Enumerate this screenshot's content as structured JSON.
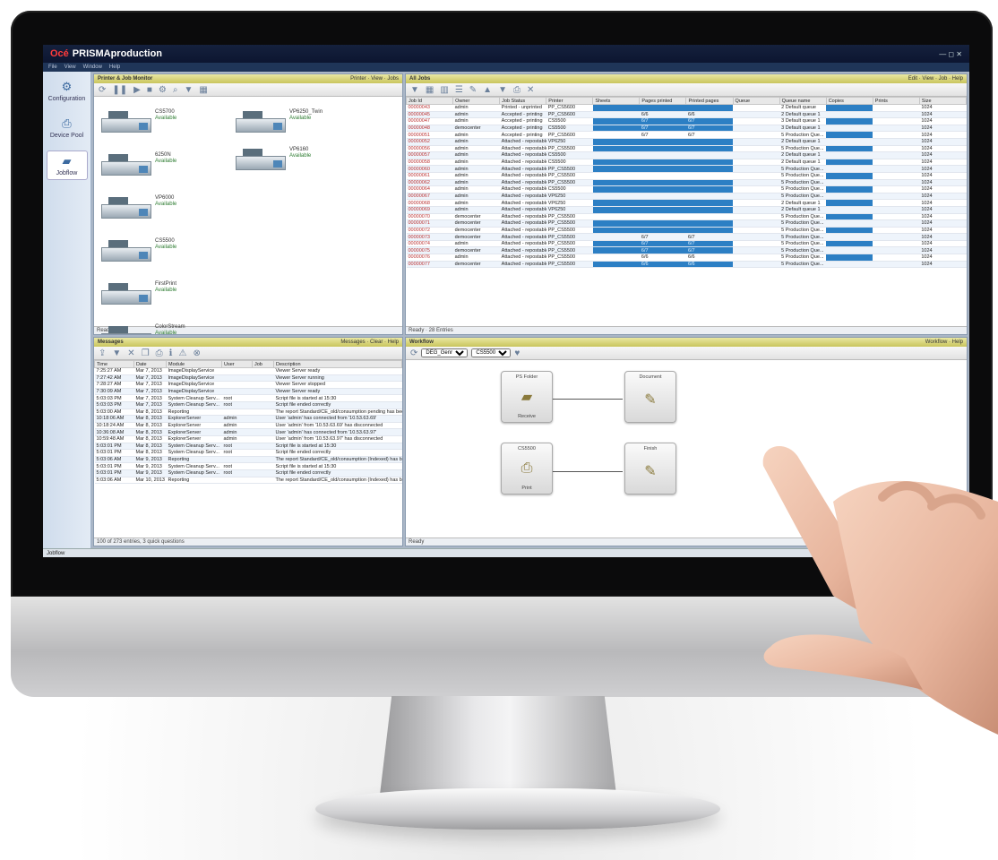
{
  "app": {
    "brand": "Océ",
    "title": "PRISMAproduction",
    "window_controls": "— ◻ ✕",
    "menu": [
      "File",
      "View",
      "Window",
      "Help"
    ]
  },
  "nav": [
    {
      "label": "Configuration",
      "icon": "gear-icon"
    },
    {
      "label": "Device Pool",
      "icon": "printer-icon"
    },
    {
      "label": "Jobflow",
      "icon": "folder-icon"
    }
  ],
  "printers_pane": {
    "title": "Printer & Job Monitor",
    "links": "Printer · View · Jobs",
    "status": "Ready",
    "printers": [
      {
        "name": "CS5700",
        "status": "Available"
      },
      {
        "name": "VP6250_Twin",
        "status": "Available"
      },
      {
        "name": "6250N",
        "status": "Available"
      },
      {
        "name": "VP6160",
        "status": "Available"
      },
      {
        "name": "VP6000",
        "status": "Available"
      },
      {
        "name": "CS5500",
        "status": "Available"
      },
      {
        "name": "FirstPrint",
        "status": "Available"
      },
      {
        "name": "ColorStream",
        "status": "Available"
      }
    ]
  },
  "jobs_pane": {
    "title": "All Jobs",
    "links": "Edit · View · Job · Help",
    "status": "Ready · 28 Entries",
    "columns": [
      "Job Id",
      "Owner",
      "Job Status",
      "Printer",
      "Sheets",
      "Pages printed",
      "Printed pages",
      "Queue",
      "Queue name",
      "Copies",
      "Prints",
      "Size"
    ],
    "rows": [
      [
        "00000043",
        "admin",
        "Printed - unprinted",
        "PP_CS5600",
        "",
        "",
        "",
        "",
        "2 Default queue",
        "",
        "",
        "1024"
      ],
      [
        "00000045",
        "admin",
        "Accepted - printing",
        "PP_CS5600",
        "",
        "6/6",
        "6/6",
        "",
        "2 Default queue 1",
        "",
        "",
        "1024"
      ],
      [
        "00000047",
        "admin",
        "Accepted - printing",
        "CS5500",
        "",
        "6/7",
        "6/7",
        "",
        "3 Default queue 1",
        "",
        "",
        "1024"
      ],
      [
        "00000048",
        "democenter",
        "Accepted - printing",
        "CS5500",
        "",
        "6/7",
        "6/7",
        "",
        "3 Default queue 1",
        "",
        "",
        "1024"
      ],
      [
        "00000051",
        "admin",
        "Accepted - printing",
        "PP_CS5600",
        "",
        "6/7",
        "6/7",
        "",
        "5 Production Que...",
        "",
        "",
        "1024"
      ],
      [
        "00000052",
        "admin",
        "Attached - repostable",
        "VP6250",
        "",
        "",
        "",
        "",
        "2 Default queue 1",
        "",
        "",
        "1024"
      ],
      [
        "00000056",
        "admin",
        "Attached - repostable",
        "PP_CS5500",
        "",
        "",
        "",
        "",
        "5 Production Que...",
        "",
        "",
        "1024"
      ],
      [
        "00000057",
        "admin",
        "Attached - repostable",
        "CS5500",
        "",
        "",
        "",
        "",
        "2 Default queue 1",
        "",
        "",
        "1024"
      ],
      [
        "00000058",
        "admin",
        "Attached - repostable",
        "CS5500",
        "",
        "",
        "",
        "",
        "2 Default queue 1",
        "",
        "",
        "1024"
      ],
      [
        "00000060",
        "admin",
        "Attached - repostable",
        "PP_CS5500",
        "",
        "",
        "",
        "",
        "5 Production Que...",
        "",
        "",
        "1024"
      ],
      [
        "00000061",
        "admin",
        "Attached - repostable",
        "PP_CS5500",
        "",
        "",
        "",
        "",
        "5 Production Que...",
        "",
        "",
        "1024"
      ],
      [
        "00000062",
        "admin",
        "Attached - repostable",
        "PP_CS5500",
        "",
        "",
        "",
        "",
        "5 Production Que...",
        "",
        "",
        "1024"
      ],
      [
        "00000064",
        "admin",
        "Attached - repostable",
        "CS5500",
        "",
        "",
        "",
        "",
        "5 Production Que...",
        "",
        "",
        "1024"
      ],
      [
        "00000067",
        "admin",
        "Attached - repostable",
        "VP6250",
        "",
        "",
        "",
        "",
        "5 Production Que...",
        "",
        "",
        "1024"
      ],
      [
        "00000068",
        "admin",
        "Attached - repostable",
        "VP6250",
        "",
        "",
        "",
        "",
        "2 Default queue 1",
        "",
        "",
        "1024"
      ],
      [
        "00000069",
        "admin",
        "Attached - repostable",
        "VP6250",
        "",
        "",
        "",
        "",
        "2 Default queue 1",
        "",
        "",
        "1024"
      ],
      [
        "00000070",
        "democenter",
        "Attached - repostable",
        "PP_CS5500",
        "",
        "",
        "",
        "",
        "5 Production Que...",
        "",
        "",
        "1024"
      ],
      [
        "00000071",
        "democenter",
        "Attached - repostable",
        "PP_CS5500",
        "",
        "",
        "",
        "",
        "5 Production Que...",
        "",
        "",
        "1024"
      ],
      [
        "00000072",
        "democenter",
        "Attached - repostable",
        "PP_CS5500",
        "",
        "",
        "",
        "",
        "5 Production Que...",
        "",
        "",
        "1024"
      ],
      [
        "00000073",
        "democenter",
        "Attached - repostable",
        "PP_CS5500",
        "",
        "6/7",
        "6/7",
        "",
        "5 Production Que...",
        "",
        "",
        "1024"
      ],
      [
        "00000074",
        "admin",
        "Attached - repostable",
        "PP_CS5500",
        "",
        "6/7",
        "6/7",
        "",
        "5 Production Que...",
        "",
        "",
        "1024"
      ],
      [
        "00000075",
        "democenter",
        "Attached - repostable",
        "PP_CS5500",
        "",
        "6/7",
        "6/7",
        "",
        "5 Production Que...",
        "",
        "",
        "1024"
      ],
      [
        "00000076",
        "admin",
        "Attached - repostable",
        "PP_CS5500",
        "",
        "6/6",
        "6/6",
        "",
        "5 Production Que...",
        "",
        "",
        "1024"
      ],
      [
        "00000077",
        "democenter",
        "Attached - repostable",
        "PP_CS5500",
        "",
        "6/6",
        "6/6",
        "",
        "5 Production Que...",
        "",
        "",
        "1024"
      ]
    ]
  },
  "messages_pane": {
    "title": "Messages",
    "links": "Messages · Clear · Help",
    "status": "100 of 273 entries, 3 quick questions",
    "columns": [
      "Time",
      "Date",
      "Module",
      "User",
      "Job",
      "Description"
    ],
    "rows": [
      [
        "7:25:27 AM",
        "Mar 7, 2013",
        "ImageDisplayService",
        "",
        "",
        "Viewer Server ready"
      ],
      [
        "7:27:42 AM",
        "Mar 7, 2013",
        "ImageDisplayService",
        "",
        "",
        "Viewer Server running"
      ],
      [
        "7:28:27 AM",
        "Mar 7, 2013",
        "ImageDisplayService",
        "",
        "",
        "Viewer Server stopped"
      ],
      [
        "7:30:09 AM",
        "Mar 7, 2013",
        "ImageDisplayService",
        "",
        "",
        "Viewer Server ready"
      ],
      [
        "5:03:03 PM",
        "Mar 7, 2013",
        "System Cleanup Serv...",
        "root",
        "",
        "Script file is started at 15:30"
      ],
      [
        "5:03:03 PM",
        "Mar 7, 2013",
        "System Cleanup Serv...",
        "root",
        "",
        "Script file ended correctly"
      ],
      [
        "5:03:00 AM",
        "Mar 8, 2013",
        "Reporting",
        "",
        "",
        "The report Standard/CE_old/consumption pending has been generated"
      ],
      [
        "10:18:06 AM",
        "Mar 8, 2013",
        "ExplorerServer",
        "admin",
        "",
        "User 'admin' has connected from '10.53.63.69'"
      ],
      [
        "10:18:24 AM",
        "Mar 8, 2013",
        "ExplorerServer",
        "admin",
        "",
        "User 'admin' from '10.53.63.69' has disconnected"
      ],
      [
        "10:36:08 AM",
        "Mar 8, 2013",
        "ExplorerServer",
        "admin",
        "",
        "User 'admin' has connected from '10.53.63.97'"
      ],
      [
        "10:59:48 AM",
        "Mar 8, 2013",
        "ExplorerServer",
        "admin",
        "",
        "User 'admin' from '10.53.63.97' has disconnected"
      ],
      [
        "5:03:01 PM",
        "Mar 8, 2013",
        "System Cleanup Serv...",
        "root",
        "",
        "Script file is started at 15:30"
      ],
      [
        "5:03:01 PM",
        "Mar 8, 2013",
        "System Cleanup Serv...",
        "root",
        "",
        "Script file ended correctly"
      ],
      [
        "5:03:06 AM",
        "Mar 9, 2013",
        "Reporting",
        "",
        "",
        "The report Standard/CE_old/consumption (Indexed) has been generated"
      ],
      [
        "5:03:01 PM",
        "Mar 9, 2013",
        "System Cleanup Serv...",
        "root",
        "",
        "Script file is started at 15:30"
      ],
      [
        "5:03:01 PM",
        "Mar 9, 2013",
        "System Cleanup Serv...",
        "root",
        "",
        "Script file ended correctly"
      ],
      [
        "5:03:06 AM",
        "Mar 10, 2013",
        "Reporting",
        "",
        "",
        "The report Standard/CE_old/consumption (Indexed) has been generated"
      ]
    ]
  },
  "workflow_pane": {
    "title": "Workflow",
    "links": "Workflow · Help",
    "job_select": "DEG_Genre",
    "printer_select": "CS5500",
    "status": "Ready",
    "nodes": [
      {
        "label": "PS Folder",
        "sub": "Receive",
        "icon": "folder-icon"
      },
      {
        "label": "Document",
        "sub": "",
        "icon": "document-icon"
      },
      {
        "label": "CS5500",
        "sub": "Print",
        "icon": "printer-icon"
      },
      {
        "label": "Finish",
        "sub": "",
        "icon": "document-icon"
      }
    ]
  },
  "taskbar": {
    "label": "Jobflow"
  }
}
